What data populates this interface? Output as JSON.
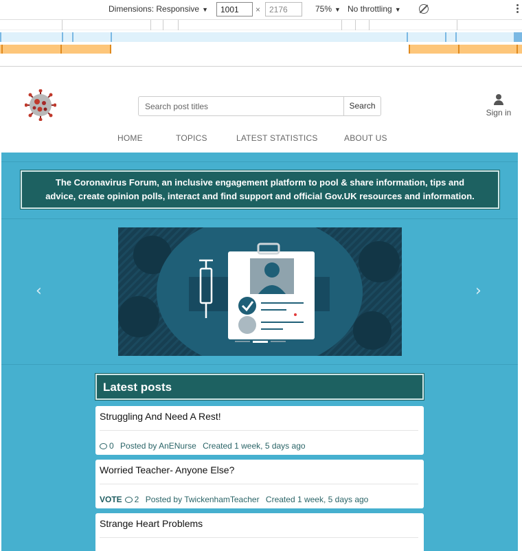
{
  "devtools": {
    "dimensions_label": "Dimensions: Responsive",
    "width_value": "1001",
    "times": "×",
    "height_value": "2176",
    "zoom": "75%",
    "throttling": "No throttling",
    "caret": "▼"
  },
  "search": {
    "placeholder": "Search post titles",
    "button_label": "Search"
  },
  "account": {
    "signin_label": "Sign in"
  },
  "nav": {
    "items": [
      "HOME",
      "TOPICS",
      "LATEST STATISTICS",
      "ABOUT US"
    ]
  },
  "banner": {
    "line1": "The Coronavirus Forum, an inclusive engagement platform to pool & share information, tips and",
    "line2": "advice, create opinion polls, interact and find support and official Gov.UK resources and information."
  },
  "carousel": {
    "prev": "‹",
    "next": "›",
    "active_slide": 1,
    "slide_count": 3
  },
  "latest": {
    "heading": "Latest posts",
    "posts": [
      {
        "title": "Struggling And Need A Rest!",
        "vote": "",
        "comments": "0",
        "posted_by": "Posted by AnENurse",
        "created": "Created 1 week, 5 days ago"
      },
      {
        "title": "Worried Teacher- Anyone Else?",
        "vote": "VOTE",
        "comments": "2",
        "posted_by": "Posted by TwickenhamTeacher",
        "created": "Created 1 week, 5 days ago"
      },
      {
        "title": "Strange Heart Problems",
        "vote": "",
        "comments": "",
        "posted_by": "",
        "created": ""
      }
    ]
  },
  "colors": {
    "page_bg": "#46b0cf",
    "panel_dark": "#1d6161",
    "link_teal": "#2a6467"
  }
}
